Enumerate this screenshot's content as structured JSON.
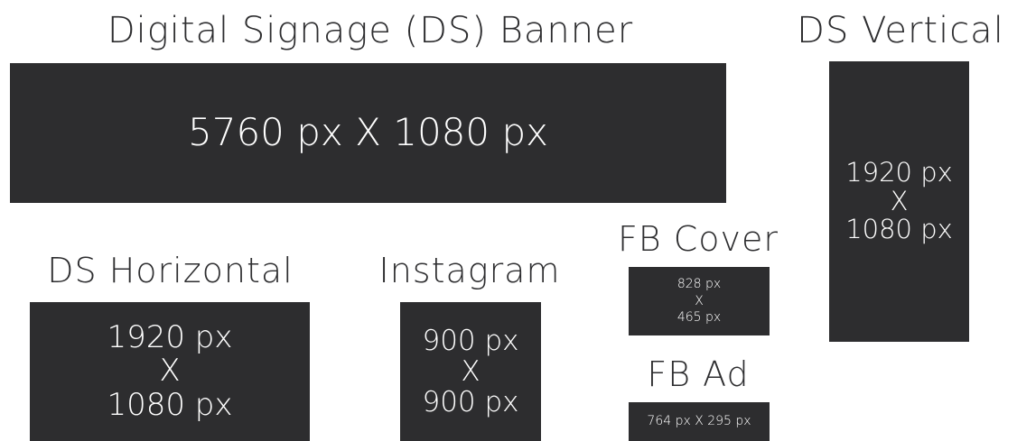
{
  "banner": {
    "title": "Digital Signage (DS) Banner",
    "size": "5760 px X 1080 px"
  },
  "vertical": {
    "title": "DS Vertical",
    "width": "1920 px",
    "sep": "X",
    "height": "1080 px"
  },
  "horizontal": {
    "title": "DS Horizontal",
    "width": "1920 px",
    "sep": "X",
    "height": "1080 px"
  },
  "instagram": {
    "title": "Instagram",
    "width": "900 px",
    "sep": "X",
    "height": "900 px"
  },
  "fb_cover": {
    "title": "FB Cover",
    "width": "828 px",
    "sep": "X",
    "height": "465 px"
  },
  "fb_ad": {
    "title": "FB Ad",
    "size": "764 px X 295 px"
  },
  "colors": {
    "box_fill": "#2d2d2f",
    "box_text": "#ffffff",
    "label_text": "#2d2d2f",
    "background": "#ffffff"
  }
}
